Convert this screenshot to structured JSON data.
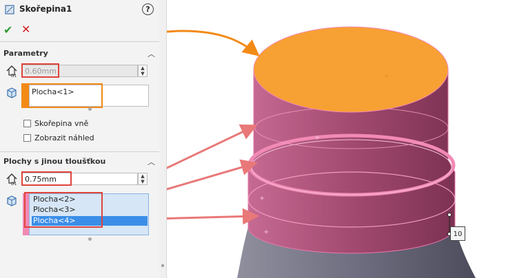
{
  "panel": {
    "title": "Skořepina1",
    "help_label": "?",
    "ok_label": "✔",
    "cancel_label": "✕"
  },
  "parametry": {
    "title": "Parametry",
    "thickness_value": "0.60mm",
    "faces": [
      "Plocha<1>"
    ],
    "shell_outward_label": "Skořepina vně",
    "preview_label": "Zobrazit náhled"
  },
  "multi_thickness": {
    "title": "Plochy s jinou tloušťkou",
    "thickness_value": "0.75mm",
    "faces": [
      "Plocha<2>",
      "Plocha<3>",
      "Plocha<4>"
    ],
    "selected_index": 2
  },
  "viewport": {
    "dimension_label": "10"
  },
  "colors": {
    "top_face": "#f7a033",
    "cylinder_body": "#a04a6e",
    "highlight_pink": "#f28ab6",
    "annotation_red": "#e0443c",
    "annotation_orange": "#f28a16",
    "selection_blue": "#3b8ee8"
  }
}
